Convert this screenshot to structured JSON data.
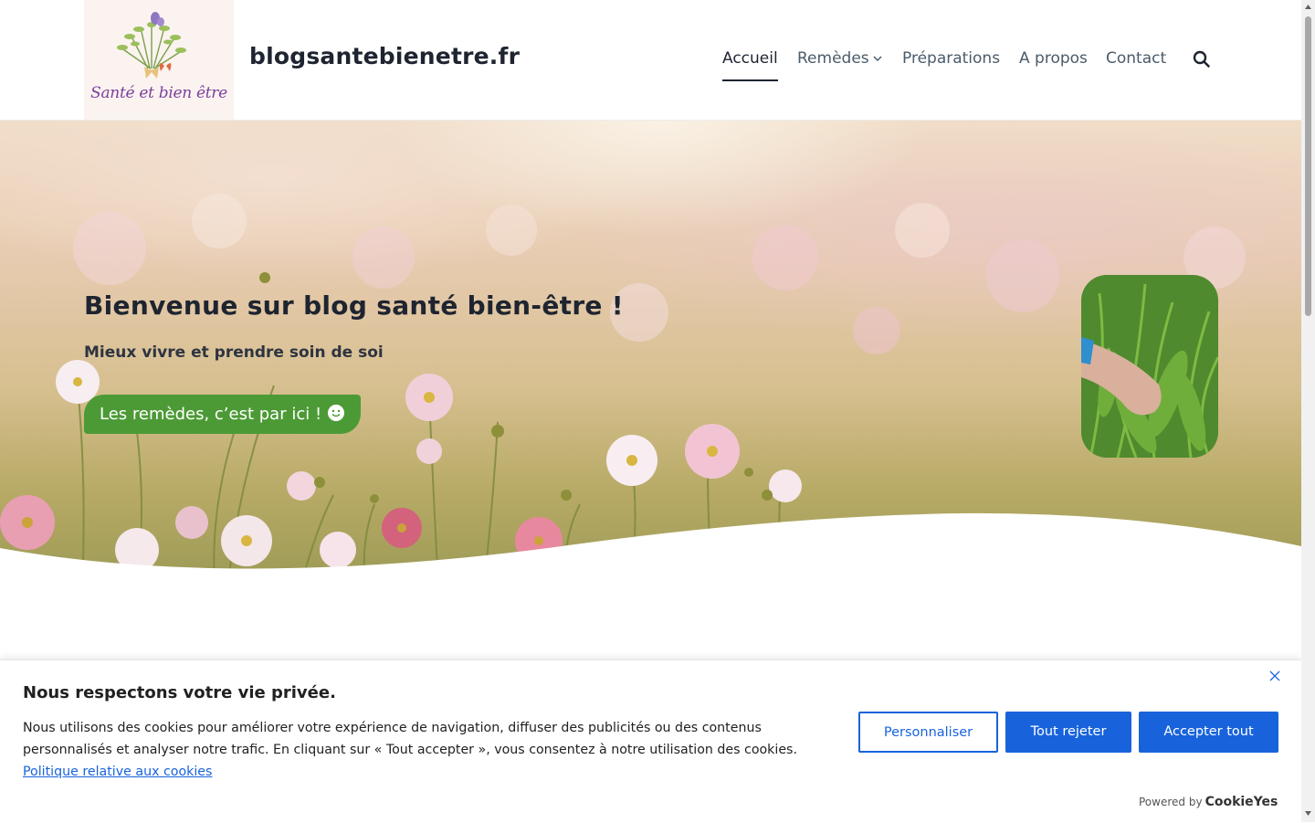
{
  "site": {
    "logo_text": "Santé et bien être",
    "title": "blogsantebienetre.fr"
  },
  "nav": {
    "items": [
      {
        "label": "Accueil",
        "active": true
      },
      {
        "label": "Remèdes",
        "has_dropdown": true
      },
      {
        "label": "Préparations"
      },
      {
        "label": "A propos"
      },
      {
        "label": "Contact"
      }
    ],
    "search_icon": "search-icon"
  },
  "hero": {
    "title": "Bienvenue sur blog santé bien-être !",
    "subtitle": "Mieux vivre et prendre soin de soi",
    "button_label": "Les remèdes, c’est par ici !",
    "button_icon": "smiley-icon",
    "button_color": "#4c9a36"
  },
  "cookie": {
    "title": "Nous respectons votre vie privée.",
    "text": "Nous utilisons des cookies pour améliorer votre expérience de navigation, diffuser des publicités ou des contenus personnalisés et analyser notre trafic. En cliquant sur « Tout accepter », vous consentez à notre utilisation des cookies.",
    "policy_link": "Politique relative aux cookies",
    "customize_label": "Personnaliser",
    "reject_label": "Tout rejeter",
    "accept_label": "Accepter tout",
    "powered_by": "Powered by",
    "brand": "CookieYes",
    "accent": "#1863dc"
  }
}
